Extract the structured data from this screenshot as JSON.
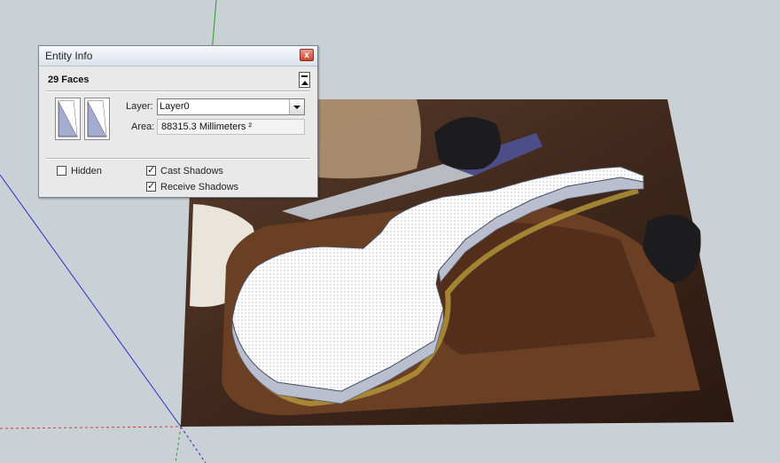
{
  "dialog": {
    "title": "Entity Info",
    "close_label": "x",
    "selection_title": "29 Faces",
    "layer_label": "Layer:",
    "layer_value": "Layer0",
    "area_label": "Area:",
    "area_value": "88315.3 Millimeters ²",
    "hidden_label": "Hidden",
    "hidden_checked": false,
    "cast_shadows_label": "Cast Shadows",
    "cast_shadows_checked": true,
    "receive_shadows_label": "Receive Shadows",
    "receive_shadows_checked": true
  },
  "colors": {
    "viewport_background": "#c9d1d6",
    "green_axis": "#2a9d2a",
    "red_axis": "#d33a3a",
    "blue_axis": "#2a2acc",
    "face_fill": "#ffffff",
    "face_side": "#b9bfcf"
  },
  "icons": {
    "close": "close-icon",
    "collapse": "collapse-panel-icon",
    "dropdown": "chevron-down-icon"
  }
}
